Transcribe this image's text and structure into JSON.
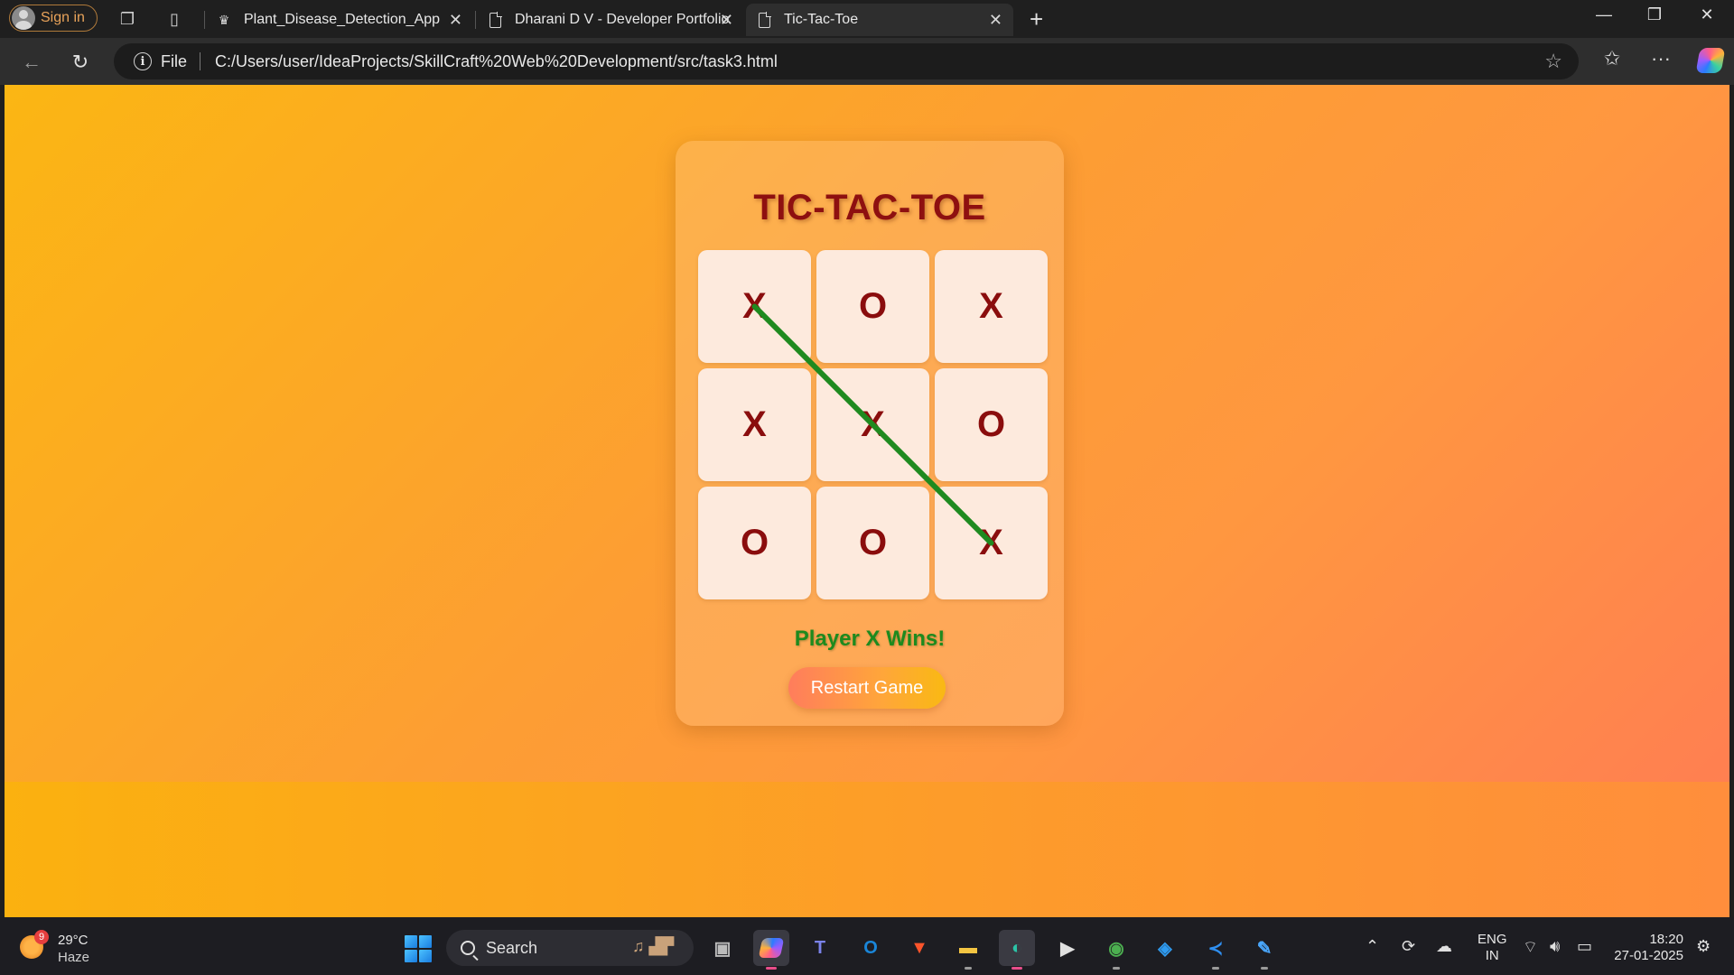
{
  "browser": {
    "sign_in_label": "Sign in",
    "tabs": [
      {
        "label": "Plant_Disease_Detection_App",
        "icon": "crown-icon"
      },
      {
        "label": "Dharani D V - Developer Portfolio",
        "icon": "page-icon"
      },
      {
        "label": "Tic-Tac-Toe",
        "icon": "page-icon",
        "active": true
      }
    ],
    "address": {
      "scheme_label": "File",
      "url": "C:/Users/user/IdeaProjects/SkillCraft%20Web%20Development/src/task3.html"
    }
  },
  "game": {
    "title": "TIC-TAC-TOE",
    "board": [
      "X",
      "O",
      "X",
      "X",
      "X",
      "O",
      "O",
      "O",
      "X"
    ],
    "winning_line": [
      0,
      4,
      8
    ],
    "status": "Player X Wins!",
    "restart_label": "Restart Game",
    "colors": {
      "title": "#8e1010",
      "mark": "#8a0d0d",
      "cell": "#fdeadd",
      "win_line": "#1f8a1f",
      "status": "#1e8a1e"
    }
  },
  "taskbar": {
    "weather": {
      "badge": "9",
      "temp": "29°C",
      "condition": "Haze"
    },
    "search_label": "Search",
    "apps": [
      "file-explorer-icon",
      "copilot-icon",
      "teams-icon",
      "outlook-icon",
      "brave-icon",
      "folder-icon",
      "edge-icon",
      "media-player-icon",
      "chrome-icon",
      "m365-icon",
      "vscode-icon",
      "paint-icon"
    ],
    "language": {
      "line1": "ENG",
      "line2": "IN"
    },
    "clock": {
      "time": "18:20",
      "date": "27-01-2025"
    }
  }
}
